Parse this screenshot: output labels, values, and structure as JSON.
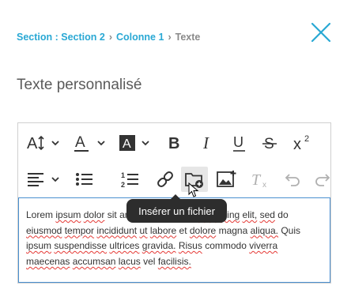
{
  "breadcrumb": {
    "section": "Section : Section 2",
    "column": "Colonne 1",
    "current": "Texte",
    "separator": "›"
  },
  "page_title": "Texte personnalisé",
  "toolbar": {
    "row1": [
      "font-size-icon",
      "text-color-icon",
      "background-color-icon",
      "bold-icon",
      "italic-icon",
      "underline-icon",
      "strikethrough-icon",
      "superscript-icon"
    ],
    "row2": [
      "align-left-icon",
      "bulleted-list-icon",
      "numbered-list-icon",
      "link-icon",
      "insert-file-icon",
      "insert-image-icon",
      "clear-format-icon",
      "undo-icon",
      "redo-icon"
    ],
    "font_size_glyph": "A",
    "text_color_glyph": "A",
    "bg_color_glyph": "A",
    "bold_glyph": "B",
    "italic_glyph": "I",
    "underline_glyph": "U",
    "strike_glyph": "S",
    "superscript_base": "x",
    "superscript_exp": "2",
    "clear_glyph": "T",
    "clear_sub": "x",
    "list_numbers": [
      "1",
      "2"
    ]
  },
  "tooltip": "Insérer un fichier",
  "editor_text": {
    "w01": "Lorem",
    "w02": "ipsum",
    "w03": "dolor",
    "w04": "sit amet, consectetur",
    "w05": "adipiscing",
    "w06": "elit,",
    "w07": "sed",
    "w08": "do",
    "w09": "eiusmod",
    "w10": "tempor",
    "w11": "incididunt",
    "w12": "ut",
    "w13": "labore",
    "w14": "et",
    "w15": "dolore",
    "w16": "magna",
    "w17": "aliqua.",
    "w18": "Quis",
    "w19": "ipsum",
    "w20": "suspendisse",
    "w21": "ultrices",
    "w22": "gravida.",
    "w23": "Risus",
    "w24": "commodo",
    "w25": "viverra",
    "w26": "maecenas",
    "w27": "accumsan",
    "w28": "lacus",
    "w29": "vel",
    "w30": "facilisis."
  },
  "colors": {
    "accent": "#29a8d4",
    "icon": "#333333",
    "muted_icon": "#b0b0b0",
    "tooltip_bg": "#2d2d2d",
    "focus_border": "#4a8fd0",
    "spell_underline": "#e53935"
  }
}
